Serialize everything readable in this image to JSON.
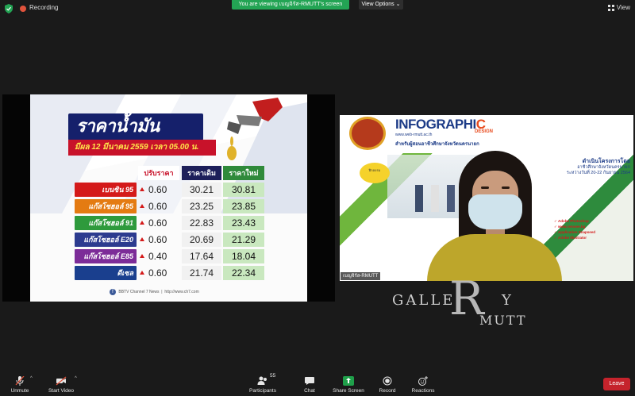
{
  "topbar": {
    "recording_label": "Recording",
    "viewing_banner": "You are viewing เบญจิรัส-RMUTT's screen",
    "view_options_label": "View Options",
    "view_label": "View"
  },
  "slide": {
    "title": "ราคาน้ำมัน",
    "date_line": "มีผล 12 มีนาคม 2559 เวลา 05.00 น.",
    "col_change": "ปรับราคา",
    "col_old": "ราคาเดิม",
    "col_new": "ราคาใหม่",
    "rows": [
      {
        "fuel": "เบนซิน 95",
        "change": "0.60",
        "old": "30.21",
        "new": "30.81",
        "color": "#d41a1a"
      },
      {
        "fuel": "แก๊สโซฮอล์ 95",
        "change": "0.60",
        "old": "23.25",
        "new": "23.85",
        "color": "#e47b12"
      },
      {
        "fuel": "แก๊สโซฮอล์ 91",
        "change": "0.60",
        "old": "22.83",
        "new": "23.43",
        "color": "#2e9a3c"
      },
      {
        "fuel": "แก๊สโซฮอล์ E20",
        "change": "0.60",
        "old": "20.69",
        "new": "21.29",
        "color": "#2c3b8f"
      },
      {
        "fuel": "แก๊สโซฮอล์ E85",
        "change": "0.40",
        "old": "17.64",
        "new": "18.04",
        "color": "#7c2c98"
      },
      {
        "fuel": "ดีเซล",
        "change": "0.60",
        "old": "21.74",
        "new": "22.34",
        "color": "#1a3f8e"
      }
    ],
    "footer_source": "BBTV Channel 7 News",
    "footer_url": "http://www.ch7.com"
  },
  "webcam": {
    "infographic_title_a": "INFOGRAPHI",
    "infographic_title_b": "C",
    "design_label": "DESIGN",
    "url_text": "www.web-rmutt.ac.th",
    "subtitle": "สำหรับผู้สอนอาชีวศึกษาจังหวัดนครนายก",
    "badge_text": "ฝึกอบรม",
    "right_heading": "ดำเนินโครงการโดย",
    "right_sub1": "อาชีวศึกษาจังหวัดนครนายก",
    "right_sub2": "ระหว่างวันที่ 20-22 กันยายน 2564",
    "bullets": [
      "Adobe Photoshop",
      "www.remove.bg",
      "Application Snapseed",
      "Adobe Illustrator"
    ],
    "name_tag": "เบญจิรัส-RMUTT"
  },
  "watermark": {
    "gal": "GALLE",
    "R": "R",
    "y": "Y",
    "mutt": "MUTT"
  },
  "toolbar": {
    "unmute": "Unmute",
    "start_video": "Start Video",
    "participants": "Participants",
    "participants_count": "55",
    "chat": "Chat",
    "share_screen": "Share Screen",
    "record": "Record",
    "reactions": "Reactions",
    "leave": "Leave"
  },
  "colors": {
    "zoom_green": "#23a454",
    "leave_red": "#c5232c",
    "background": "#1a1a1a"
  }
}
